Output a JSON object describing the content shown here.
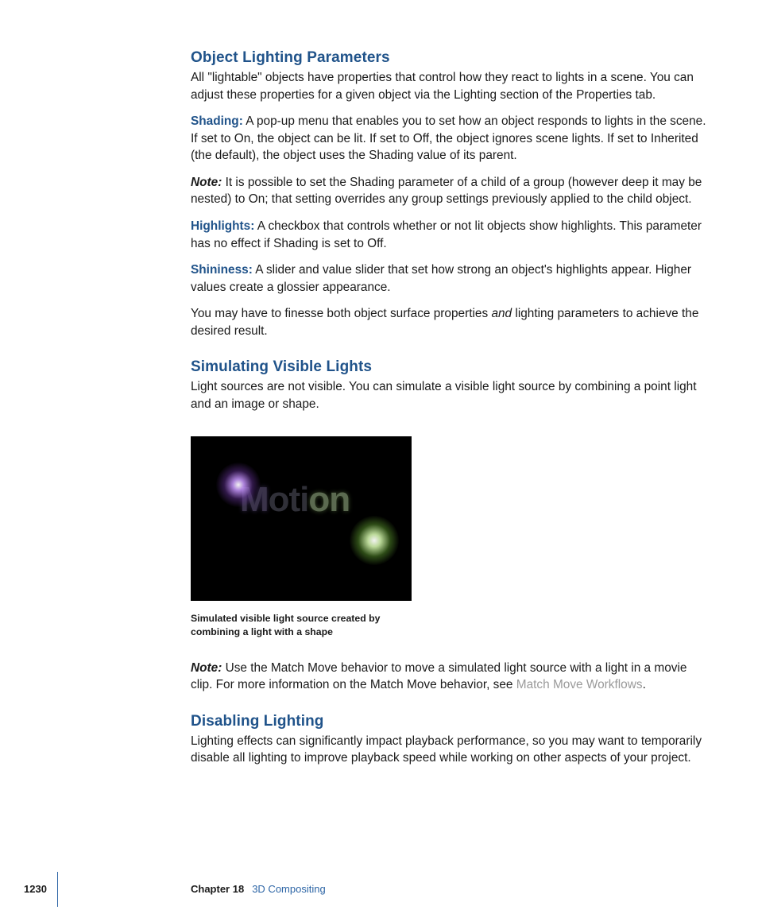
{
  "sections": {
    "s1": {
      "heading": "Object Lighting Parameters",
      "intro": "All \"lightable\" objects have properties that control how they react to lights in a scene. You can adjust these properties for a given object via the Lighting section of the Properties tab.",
      "shading_term": "Shading:",
      "shading_text": "  A pop-up menu that enables you to set how an object responds to lights in the scene. If set to On, the object can be lit. If set to Off, the object ignores scene lights. If set to Inherited (the default), the object uses the Shading value of its parent.",
      "note1_label": "Note:",
      "note1_text": "  It is possible to set the Shading parameter of a child of a group (however deep it may be nested) to On; that setting overrides any group settings previously applied to the child object.",
      "highlights_term": "Highlights:",
      "highlights_text": "  A checkbox that controls whether or not lit objects show highlights. This parameter has no effect if Shading is set to Off.",
      "shininess_term": "Shininess:",
      "shininess_text": "  A slider and value slider that set how strong an object's highlights appear. Higher values create a glossier appearance.",
      "outro_a": "You may have to finesse both object surface properties ",
      "outro_i": "and",
      "outro_b": " lighting parameters to achieve the desired result."
    },
    "s2": {
      "heading": "Simulating Visible Lights",
      "body": "Light sources are not visible. You can simulate a visible light source by combining a point light and an image or shape.",
      "figure_text": "Motion",
      "caption": "Simulated visible light source created by combining a light with a shape",
      "note_label": "Note:",
      "note_a": "  Use the Match Move behavior to move a simulated light source with a light in a movie clip. For more information on the Match Move behavior, see ",
      "note_link": "Match Move Workflows",
      "note_b": "."
    },
    "s3": {
      "heading": "Disabling Lighting",
      "body": "Lighting effects can significantly impact playback performance, so you may want to temporarily disable all lighting to improve playback speed while working on other aspects of your project."
    }
  },
  "footer": {
    "page": "1230",
    "chapter_label": "Chapter 18",
    "chapter_title": "3D Compositing"
  }
}
